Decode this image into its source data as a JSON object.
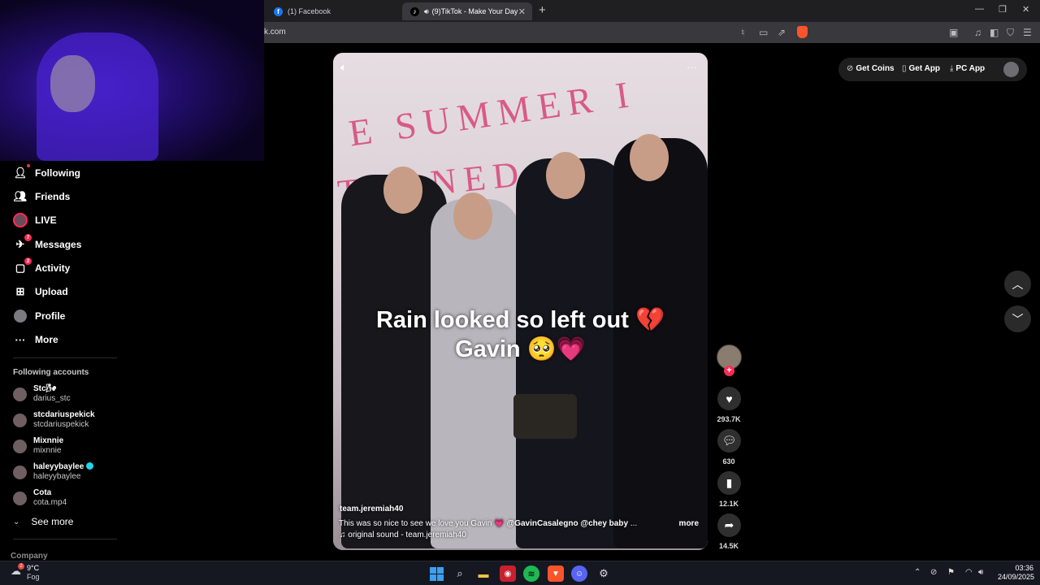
{
  "browser": {
    "tabs": [
      {
        "title": "(1) Facebook",
        "favicon": "facebook-icon"
      },
      {
        "title": "(9)TikTok - Make Your Day",
        "favicon": "tiktok-icon",
        "active": true
      }
    ],
    "url": "k.com"
  },
  "sidebar": {
    "items": [
      {
        "label": "Following",
        "icon": "following-icon"
      },
      {
        "label": "Friends",
        "icon": "friends-icon"
      },
      {
        "label": "LIVE",
        "icon": "live-avatar"
      },
      {
        "label": "Messages",
        "icon": "messages-icon",
        "badge": "7"
      },
      {
        "label": "Activity",
        "icon": "activity-icon",
        "badge": "2"
      },
      {
        "label": "Upload",
        "icon": "upload-icon"
      },
      {
        "label": "Profile",
        "icon": "profile-avatar"
      },
      {
        "label": "More",
        "icon": "more-icon"
      }
    ],
    "following_accounts_title": "Following accounts",
    "accounts": [
      {
        "name": "Stc🌬",
        "username": "darius_stc"
      },
      {
        "name": "stcdariuspekick",
        "username": "stcdariuspekick"
      },
      {
        "name": "Mixnnie",
        "username": "mixnnie"
      },
      {
        "name": "haleyybaylee",
        "username": "haleyybaylee",
        "verified": true
      },
      {
        "name": "Cota",
        "username": "cota.mp4"
      }
    ],
    "see_more": "See more",
    "company": "Company"
  },
  "video": {
    "caption_line1": "Rain looked so left out 💔",
    "caption_line2": "Gavin 🥺💗",
    "author": "team.jeremiah40",
    "description": "This was so nice to see we love you Gavin 💗",
    "tags": [
      "@GavinCasalegno",
      "@chey baby"
    ],
    "ellipsis": "...",
    "more": "more",
    "sound": "♫ original sound - team.jeremiah40",
    "sign_line1": "E SUMMER I",
    "sign_line2": "TURNED P"
  },
  "actions": {
    "likes": "293.7K",
    "comments": "630",
    "saves": "12.1K",
    "shares": "14.5K"
  },
  "topbar": {
    "get_coins": "Get Coins",
    "get_app": "Get App",
    "pc_app": "PC App"
  },
  "taskbar": {
    "temperature": "9°C",
    "condition": "Fog",
    "weather_badge": "2",
    "time": "03:36",
    "date": "24/09/2025"
  },
  "colors": {
    "accent": "#fe2c55",
    "verified": "#20d5ec",
    "sign_text": "#d85a86"
  }
}
